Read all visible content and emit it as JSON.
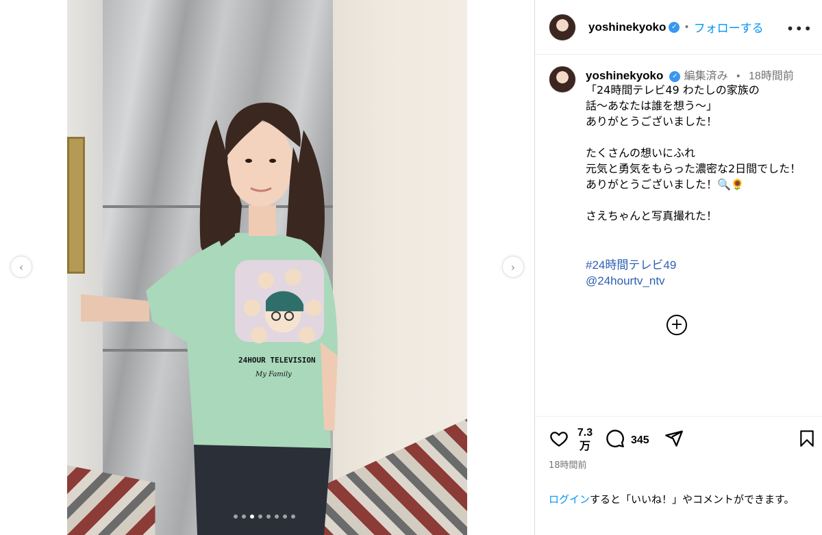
{
  "post": {
    "username": "yoshinekyoko",
    "follow_label": "フォローする",
    "edited_label": "編集済み",
    "time_ago": "18時間前",
    "caption_lines": "「24時間テレビ49 わたしの家族の\n話〜あなたは誰を想う〜」\nありがとうございました！\n\nたくさんの想いにふれ\n元気と勇気をもらった濃密な2日間でした！\nありがとうございました！🔍🌻\n\nさえちゃんと写真撮れた！",
    "hashtag": "#24時間テレビ49",
    "mention": "@24hourtv_ntv",
    "more_icon": "more-horizontal-icon"
  },
  "media": {
    "shirt_text_1": "24HOUR TELEVISION",
    "shirt_text_2": "My Family",
    "dots_total": 8,
    "dots_active_index": 2
  },
  "actions": {
    "like_count": "7.3万",
    "like_count_line1": "7.3",
    "like_count_line2": "万",
    "comment_count": "345",
    "post_time": "18時間前"
  },
  "login_prompt": {
    "link_label": "ログイン",
    "rest_text": "すると「いいね！」やコメントができます。"
  },
  "colors": {
    "link_blue": "#0095f6",
    "hashtag_blue": "#2b5fb4",
    "muted": "#737373",
    "divider": "#dbdbdb"
  }
}
